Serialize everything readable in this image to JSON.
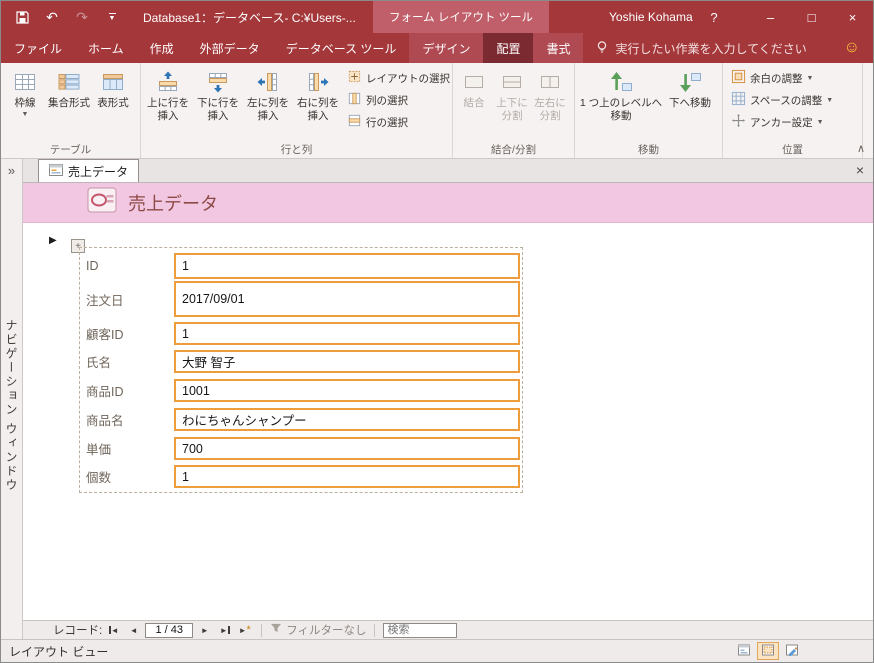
{
  "colors": {
    "titlebar": "#A4373A",
    "contextual_block": "#C05F6A",
    "selected_tab": "#7C2A31",
    "ribbon_bg": "#F6F2F2",
    "header_pink": "#F2C7E1",
    "selection_orange": "#EE9D3D",
    "disabled_text": "#B3ACA6"
  },
  "window": {
    "title": "Database1：データベース- C:¥Users-...",
    "contextual_title": "フォーム レイアウト ツール",
    "user": "Yoshie Kohama",
    "help": "?"
  },
  "glyphs": {
    "undo": "↶",
    "redo": "↷",
    "dropdown": "▼",
    "collapse_ribbon": "∧",
    "min": "–",
    "max": "□",
    "win_close": "×",
    "smiley": "☺",
    "nav_expand": "»",
    "doc_close": "×",
    "record_arrow": "▶",
    "prev": "◄",
    "next": "►",
    "new_star": "*",
    "handle_plus": "+"
  },
  "tabs": {
    "file": "ファイル",
    "home": "ホーム",
    "create": "作成",
    "external_data": "外部データ",
    "db_tools": "データベース ツール",
    "design": "デザイン",
    "arrange": "配置",
    "format": "書式",
    "tell_me": "実行したい作業を入力してください"
  },
  "ribbon": {
    "table": {
      "label": "テーブル",
      "gridlines": "枠線",
      "stacked": "集合形式",
      "tabular": "表形式"
    },
    "rows_cols": {
      "label": "行と列",
      "insert_above": "上に行を挿入",
      "insert_below": "下に行を挿入",
      "insert_left": "左に列を挿入",
      "insert_right": "右に列を挿入",
      "select_layout": "レイアウトの選択",
      "select_column": "列の選択",
      "select_row": "行の選択"
    },
    "merge_split": {
      "label": "結合/分割",
      "merge": "結合",
      "split_vertical": "上下に分割",
      "split_horizontal": "左右に分割"
    },
    "move": {
      "label": "移動",
      "move_up": "1 つ上のレベルへ移動",
      "move_down": "下へ移動"
    },
    "position": {
      "label": "位置",
      "margins": "余白の調整",
      "padding": "スペースの調整",
      "anchoring": "アンカー設定"
    }
  },
  "nav_pane": {
    "label": "ナビゲーション ウィンドウ"
  },
  "doc": {
    "tab": "売上データ",
    "header": "売上データ"
  },
  "fields": [
    {
      "label": "ID",
      "value": "1"
    },
    {
      "label": "注文日",
      "value": "2017/09/01"
    },
    {
      "label": "顧客ID",
      "value": "1"
    },
    {
      "label": "氏名",
      "value": "大野 智子"
    },
    {
      "label": "商品ID",
      "value": "1001"
    },
    {
      "label": "商品名",
      "value": "わにちゃんシャンプー"
    },
    {
      "label": "単価",
      "value": "700"
    },
    {
      "label": "個数",
      "value": "1"
    }
  ],
  "record_nav": {
    "label": "レコード:",
    "position": "1 / 43",
    "filter": "フィルターなし",
    "search": "検索"
  },
  "status": {
    "view": "レイアウト ビュー"
  }
}
